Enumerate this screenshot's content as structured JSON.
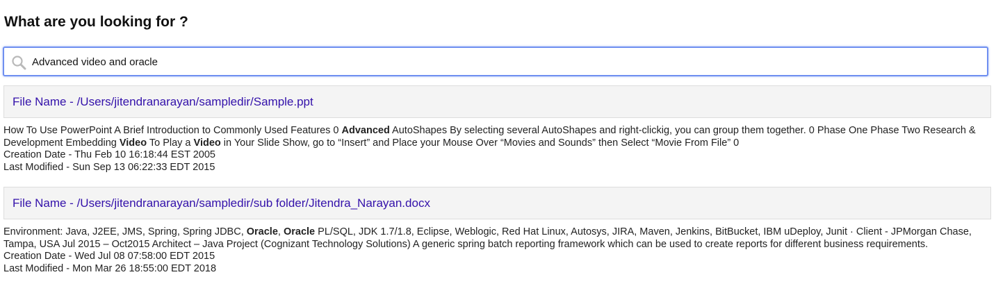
{
  "page": {
    "title": "What are you looking for ?"
  },
  "search": {
    "value": "Advanced video and oracle",
    "icon": "search-icon"
  },
  "results": [
    {
      "file_label": "File Name - /Users/jitendranarayan/sampledir/Sample.ppt",
      "snippet_parts": [
        {
          "text": "How To Use PowerPoint A Brief Introduction to Commonly Used Features 0 ",
          "bold": false
        },
        {
          "text": "Advanced",
          "bold": true
        },
        {
          "text": " AutoShapes By selecting several AutoShapes and right-clickig, you can group them together. 0 Phase One Phase Two Research & Development Embedding ",
          "bold": false
        },
        {
          "text": "Video",
          "bold": true
        },
        {
          "text": " To Play a ",
          "bold": false
        },
        {
          "text": "Video",
          "bold": true
        },
        {
          "text": " in Your Slide Show, go to “Insert” and Place your Mouse Over “Movies and Sounds” then Select “Movie From File” 0",
          "bold": false
        }
      ],
      "creation_date": "Creation Date - Thu Feb 10 16:18:44 EST 2005",
      "last_modified": "Last Modified - Sun Sep 13 06:22:33 EDT 2015"
    },
    {
      "file_label": "File Name - /Users/jitendranarayan/sampledir/sub folder/Jitendra_Narayan.docx",
      "snippet_parts": [
        {
          "text": "Environment: Java, J2EE, JMS, Spring, Spring JDBC, ",
          "bold": false
        },
        {
          "text": "Oracle",
          "bold": true
        },
        {
          "text": ", ",
          "bold": false
        },
        {
          "text": "Oracle",
          "bold": true
        },
        {
          "text": " PL/SQL, JDK 1.7/1.8, Eclipse, Weblogic, Red Hat Linux, Autosys, JIRA, Maven, Jenkins, BitBucket, IBM uDeploy, Junit · Client - JPMorgan Chase, Tampa, USA Jul 2015 – Oct2015 Architect – Java Project (Cognizant Technology Solutions) A generic spring batch reporting framework which can be used to create reports for different business requirements.",
          "bold": false
        }
      ],
      "creation_date": "Creation Date - Wed Jul 08 07:58:00 EDT 2015",
      "last_modified": "Last Modified - Mon Mar 26 18:55:00 EDT 2018"
    }
  ],
  "colors": {
    "link": "#3311aa",
    "header_bg": "#f4f4f4",
    "focus_border": "#6f8ff0"
  }
}
